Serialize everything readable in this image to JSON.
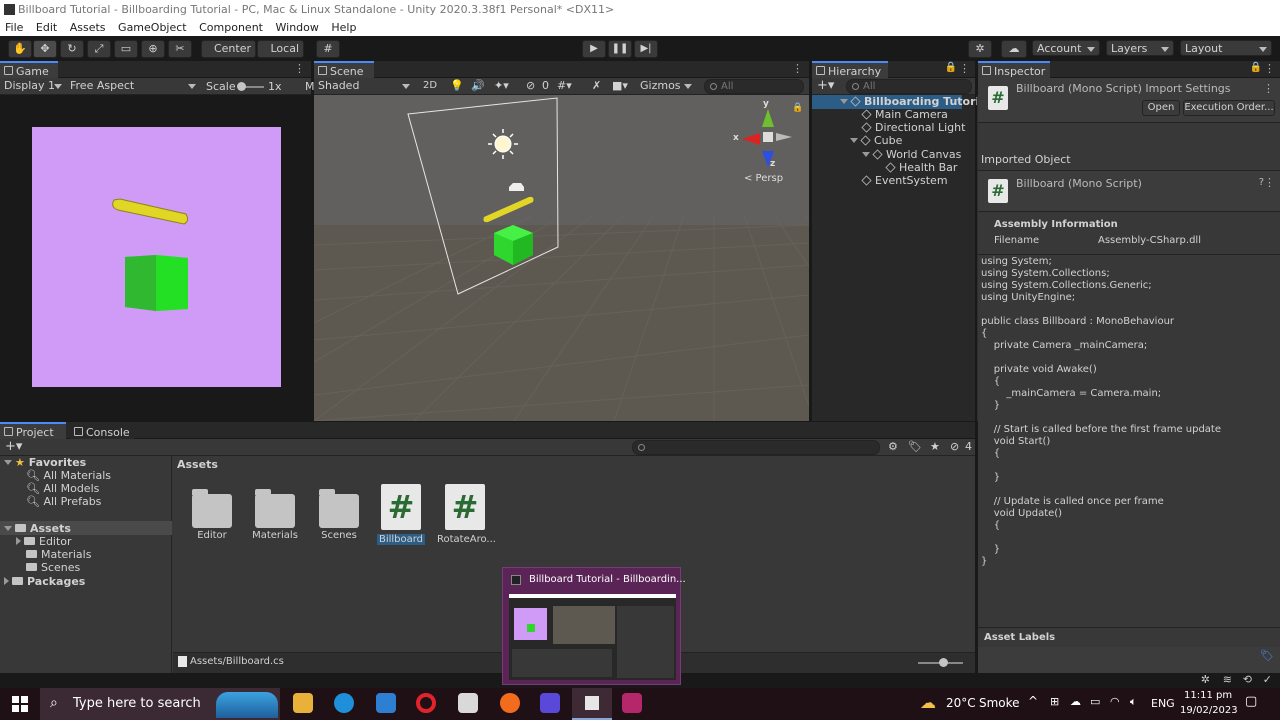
{
  "window": {
    "title": "Billboard Tutorial - Billboarding Tutorial - PC, Mac & Linux Standalone - Unity 2020.3.38f1 Personal* <DX11>"
  },
  "menu": [
    "File",
    "Edit",
    "Assets",
    "GameObject",
    "Component",
    "Window",
    "Help"
  ],
  "toolbar": {
    "center": "Center",
    "local": "Local",
    "account": "Account",
    "layers": "Layers",
    "layout": "Layout"
  },
  "game": {
    "tab": "Game",
    "display": "Display 1",
    "aspect": "Free Aspect",
    "scale_label": "Scale",
    "scale_value": "1x",
    "truncated": "M"
  },
  "scene": {
    "tab": "Scene",
    "shading": "Shaded",
    "mode2d": "2D",
    "hidden_count": "0",
    "gizmos": "Gizmos",
    "search_placeholder": "All",
    "persp": "< Persp",
    "axis_x": "x",
    "axis_y": "y",
    "axis_z": "z"
  },
  "hierarchy": {
    "tab": "Hierarchy",
    "search_placeholder": "All",
    "items": [
      "Billboarding Tutori",
      "Main Camera",
      "Directional Light",
      "Cube",
      "World Canvas",
      "Health Bar",
      "EventSystem"
    ]
  },
  "inspector": {
    "tab": "Inspector",
    "header_title": "Billboard (Mono Script) Import Settings",
    "open": "Open",
    "exec_order": "Execution Order...",
    "imported_object": "Imported Object",
    "script_title": "Billboard (Mono Script)",
    "assembly_info": "Assembly Information",
    "filename_label": "Filename",
    "filename_value": "Assembly-CSharp.dll",
    "code": "using System;\nusing System.Collections;\nusing System.Collections.Generic;\nusing UnityEngine;\n\npublic class Billboard : MonoBehaviour\n{\n    private Camera _mainCamera;\n\n    private void Awake()\n    {\n        _mainCamera = Camera.main;\n    }\n\n    // Start is called before the first frame update\n    void Start()\n    {\n\n    }\n\n    // Update is called once per frame\n    void Update()\n    {\n\n    }\n}",
    "asset_labels": "Asset Labels"
  },
  "project": {
    "tab_project": "Project",
    "tab_console": "Console",
    "hidden_count": "4",
    "favorites": "Favorites",
    "fav_items": [
      "All Materials",
      "All Models",
      "All Prefabs"
    ],
    "assets_root": "Assets",
    "asset_folders": [
      "Editor",
      "Materials",
      "Scenes"
    ],
    "packages": "Packages",
    "breadcrumb": "Assets",
    "assets": [
      {
        "name": "Editor",
        "type": "folder"
      },
      {
        "name": "Materials",
        "type": "folder"
      },
      {
        "name": "Scenes",
        "type": "folder"
      },
      {
        "name": "Billboard",
        "type": "script"
      },
      {
        "name": "RotateAro...",
        "type": "script"
      }
    ],
    "script_glyph": "#",
    "status_path": "Assets/Billboard.cs"
  },
  "popup": {
    "title": "Billboard Tutorial - Billboardin..."
  },
  "taskbar": {
    "search_placeholder": "Type here to search",
    "weather_temp": "20°C",
    "weather_desc": "Smoke",
    "lang": "ENG",
    "time": "11:11 pm",
    "date": "19/02/2023"
  },
  "colors": {
    "game_bg": "#cf9bf7",
    "cube": "#2ed62e",
    "healthbar": "#e1d626",
    "accent": "#4a8cf7",
    "selection": "#2c5d87"
  }
}
